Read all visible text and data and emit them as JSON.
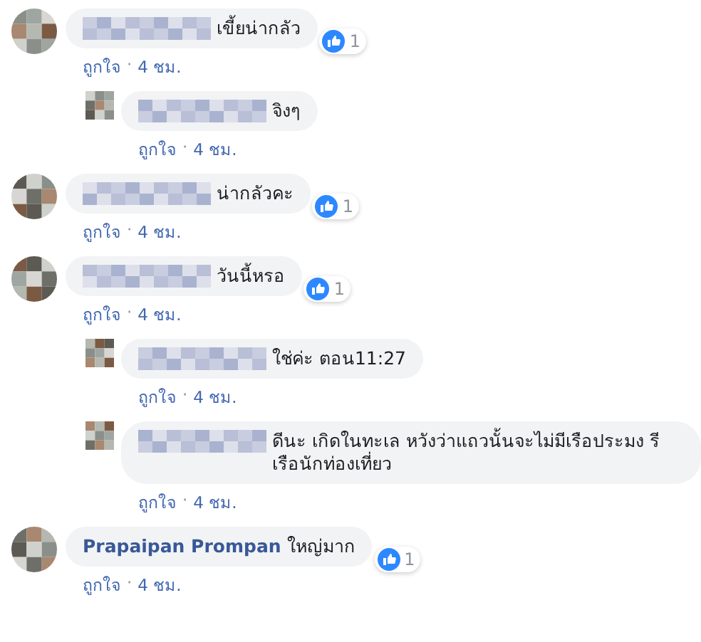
{
  "comments": [
    {
      "kind": "top",
      "author": {
        "kind": "hidden"
      },
      "text": "เขี้ยน่ากลัว",
      "reactions": "1",
      "like_link": "ถูกใจ",
      "separator": "·",
      "time": "4 ชม."
    },
    {
      "kind": "reply",
      "author": {
        "kind": "hidden"
      },
      "text": "จิงๆ",
      "like_link": "ถูกใจ",
      "separator": "·",
      "time": "4 ชม."
    },
    {
      "kind": "top",
      "author": {
        "kind": "hidden"
      },
      "text": "น่ากลัวคะ",
      "reactions": "1",
      "like_link": "ถูกใจ",
      "separator": "·",
      "time": "4 ชม."
    },
    {
      "kind": "top",
      "author": {
        "kind": "hidden"
      },
      "text": "วันนี้หรอ",
      "reactions": "1",
      "like_link": "ถูกใจ",
      "separator": "·",
      "time": "4 ชม."
    },
    {
      "kind": "reply",
      "author": {
        "kind": "hidden"
      },
      "text": "ใช่ค่ะ ตอน11:27",
      "like_link": "ถูกใจ",
      "separator": "·",
      "time": "4 ชม."
    },
    {
      "kind": "reply",
      "author": {
        "kind": "hidden"
      },
      "text": "ดีนะ เกิดในทะเล หวังว่าแถวนั้นจะไม่มีเรือประมง รี เรือนักท่องเที่ยว",
      "like_link": "ถูกใจ",
      "separator": "·",
      "time": "4 ชม."
    },
    {
      "kind": "top",
      "author": {
        "kind": "name",
        "text": "Prapaipan Prompan"
      },
      "text": "ใหญ่มาก",
      "reactions": "1",
      "like_link": "ถูกใจ",
      "separator": "·",
      "time": "4 ชม."
    }
  ]
}
